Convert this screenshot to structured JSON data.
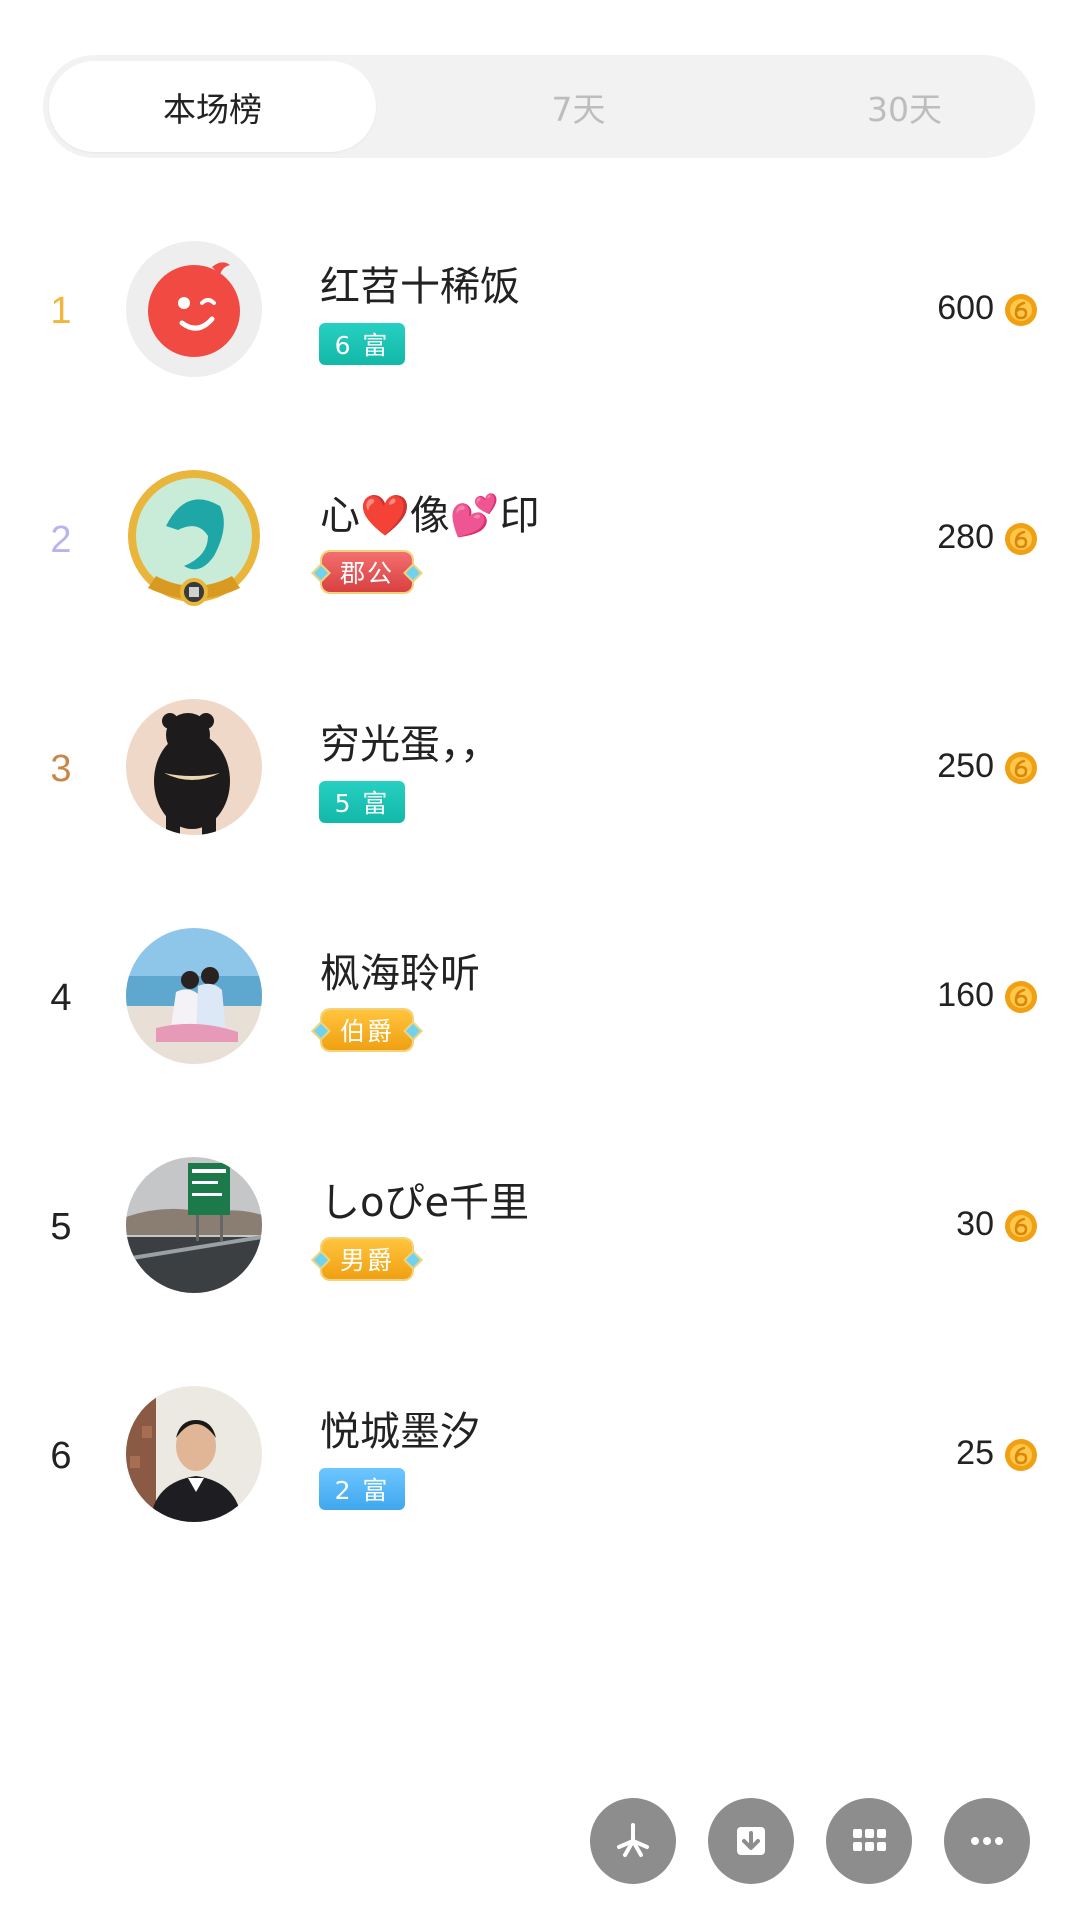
{
  "tabs": [
    {
      "label": "本场榜",
      "active": true
    },
    {
      "label": "7天",
      "active": false
    },
    {
      "label": "30天",
      "active": false
    }
  ],
  "rank_colors": {
    "1": "#f1b63a",
    "2": "#b8b4ef",
    "3": "#c7874a"
  },
  "ranking": [
    {
      "rank": "1",
      "name": "红苕十稀饭",
      "badge": "6 富",
      "score": "600"
    },
    {
      "rank": "2",
      "name": "心❤️像💕印",
      "badge": "郡公",
      "score": "280"
    },
    {
      "rank": "3",
      "name": "穷光蛋，，",
      "badge": "5 富",
      "score": "250"
    },
    {
      "rank": "4",
      "name": "枫海聆听",
      "badge": "伯爵",
      "score": "160"
    },
    {
      "rank": "5",
      "name": "しoぴe千里",
      "badge": "男爵",
      "score": "30"
    },
    {
      "rank": "6",
      "name": "悦城墨汐",
      "badge": "2 富",
      "score": "25"
    }
  ],
  "icons": {
    "coin": "coin-icon",
    "bottom_actions": [
      "share-pinwheel-icon",
      "download-icon",
      "grid-icon",
      "more-icon"
    ]
  },
  "colors": {
    "tab_track": "#f2f2f2",
    "rich_badge": "#12b8a8",
    "rich_badge_low": "#3fa7ee",
    "noble_red": "#d94040",
    "noble_gold": "#f0a012",
    "coin": "#f0a012",
    "fab": "#8d8d8d"
  }
}
